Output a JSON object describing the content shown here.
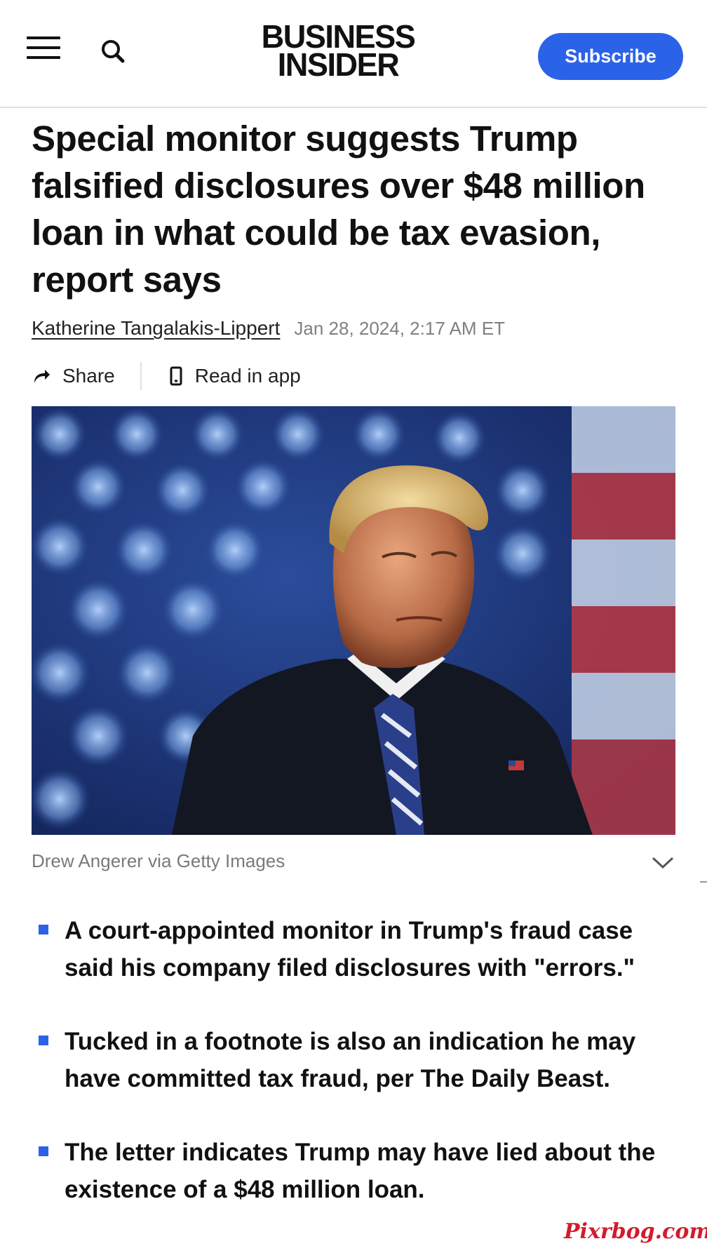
{
  "header": {
    "logo_line1": "BUSINESS",
    "logo_line2": "INSIDER",
    "subscribe_label": "Subscribe",
    "icons": [
      "hamburger-menu-icon",
      "search-icon"
    ]
  },
  "article": {
    "headline": "Special monitor suggests Trump falsified disclosures over $48 million loan in what could be tax evasion, report says",
    "author": "Katherine Tangalakis-Lippert",
    "date": "Jan 28, 2024, 2:17 AM ET",
    "actions": {
      "share_label": "Share",
      "read_in_app_label": "Read in app"
    },
    "image_caption": "Drew Angerer via Getty Images",
    "key_points": [
      "A court-appointed monitor in Trump's fraud case said his company filed disclosures with \"errors.\"",
      "Tucked in a footnote is also an indication he may have committed tax fraud, per The Daily Beast.",
      "The letter indicates Trump may have lied about the existence of a $48 million loan."
    ]
  },
  "watermark": "Pixrbog.com",
  "colors": {
    "accent": "#2b63e8",
    "text": "#111111",
    "muted": "#808080",
    "watermark": "#d21c2c"
  }
}
